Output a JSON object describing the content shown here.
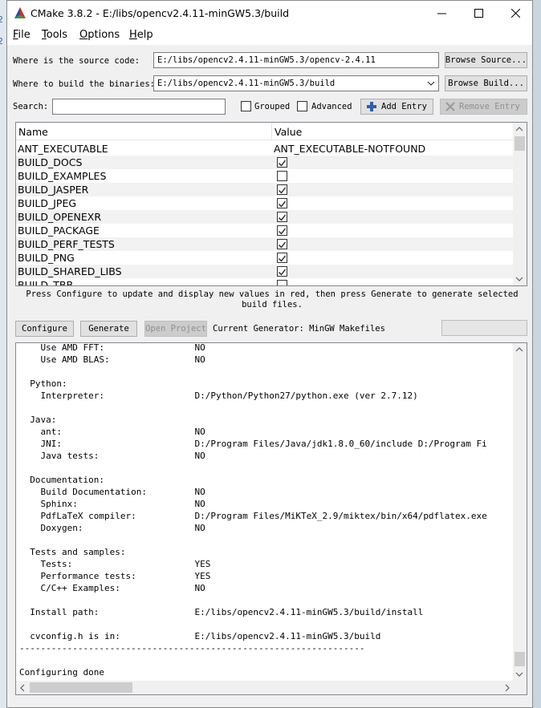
{
  "window": {
    "title": "CMake 3.8.2 - E:/libs/opencv2.4.11-minGW5.3/build"
  },
  "menu": [
    {
      "label": "File",
      "mnemonic": "F",
      "rest": "ile"
    },
    {
      "label": "Tools",
      "mnemonic": "T",
      "rest": "ools"
    },
    {
      "label": "Options",
      "mnemonic": "O",
      "rest": "ptions"
    },
    {
      "label": "Help",
      "mnemonic": "H",
      "rest": "elp"
    }
  ],
  "source": {
    "label": "Where is the source code:",
    "value": "E:/libs/opencv2.4.11-minGW5.3/opencv-2.4.11",
    "browse_label": "Browse Source..."
  },
  "binaries": {
    "label": "Where to build the binaries:",
    "value": "E:/libs/opencv2.4.11-minGW5.3/build",
    "browse_label": "Browse Build..."
  },
  "search": {
    "label": "Search:",
    "value": ""
  },
  "options": {
    "grouped_label": "Grouped",
    "advanced_label": "Advanced",
    "add_entry_label": "Add Entry",
    "remove_entry_label": "Remove Entry"
  },
  "grid": {
    "columns": [
      "Name",
      "Value"
    ],
    "rows": [
      {
        "name": "ANT_EXECUTABLE",
        "type": "text",
        "value": "ANT_EXECUTABLE-NOTFOUND"
      },
      {
        "name": "BUILD_DOCS",
        "type": "bool",
        "checked": true
      },
      {
        "name": "BUILD_EXAMPLES",
        "type": "bool",
        "checked": false
      },
      {
        "name": "BUILD_JASPER",
        "type": "bool",
        "checked": true
      },
      {
        "name": "BUILD_JPEG",
        "type": "bool",
        "checked": true
      },
      {
        "name": "BUILD_OPENEXR",
        "type": "bool",
        "checked": true
      },
      {
        "name": "BUILD_PACKAGE",
        "type": "bool",
        "checked": true
      },
      {
        "name": "BUILD_PERF_TESTS",
        "type": "bool",
        "checked": true
      },
      {
        "name": "BUILD_PNG",
        "type": "bool",
        "checked": true
      },
      {
        "name": "BUILD_SHARED_LIBS",
        "type": "bool",
        "checked": true
      },
      {
        "name": "BUILD_TBB",
        "type": "bool",
        "checked": false
      }
    ]
  },
  "hint": "Press Configure to update and display new values in red, then press Generate to generate selected build files.",
  "actions": {
    "configure_label": "Configure",
    "generate_label": "Generate",
    "open_project_label": "Open Project",
    "generator_text": "Current Generator: MinGW Makefiles"
  },
  "output": {
    "lines": [
      "    Use AMD FFT:                 NO",
      "    Use AMD BLAS:                NO",
      "",
      "  Python:",
      "    Interpreter:                 D:/Python/Python27/python.exe (ver 2.7.12)",
      "",
      "  Java:",
      "    ant:                         NO",
      "    JNI:                         D:/Program Files/Java/jdk1.8.0_60/include D:/Program Fi",
      "    Java tests:                  NO",
      "",
      "  Documentation:",
      "    Build Documentation:         NO",
      "    Sphinx:                      NO",
      "    PdfLaTeX compiler:           D:/Program Files/MiKTeX_2.9/miktex/bin/x64/pdflatex.exe",
      "    Doxygen:                     NO",
      "",
      "  Tests and samples:",
      "    Tests:                       YES",
      "    Performance tests:           YES",
      "    C/C++ Examples:              NO",
      "",
      "  Install path:                  E:/libs/opencv2.4.11-minGW5.3/build/install",
      "",
      "  cvconfig.h is in:              E:/libs/opencv2.4.11-minGW5.3/build",
      "-----------------------------------------------------------------",
      "",
      "Configuring done"
    ]
  }
}
